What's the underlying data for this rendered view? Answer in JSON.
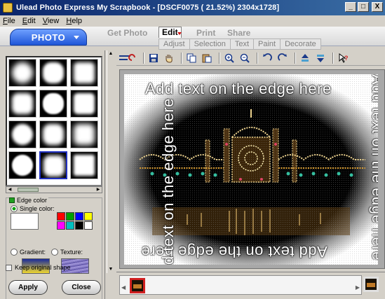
{
  "window": {
    "title": "Ulead Photo Express My Scrapbook - [DSCF0075 ( 21.52%) 2304x1728]",
    "minimize": "_",
    "maximize": "□",
    "close": "X"
  },
  "menu": [
    "File",
    "Edit",
    "View",
    "Help"
  ],
  "modes": {
    "photo": "PHOTO",
    "tabs": [
      "Get Photo",
      "Edit",
      "Print",
      "Share"
    ],
    "active_tab": "Edit"
  },
  "subtabs": [
    "Adjust",
    "Selection",
    "Text",
    "Paint",
    "Decorate"
  ],
  "edge_panel": {
    "edge_color_label": "Edge color",
    "single_color_label": "Single color:",
    "gradient_label": "Gradient:",
    "texture_label": "Texture:",
    "keep_shape_label": "Keep original shape",
    "selected_color": "#ffffff",
    "palette": [
      "#ff0000",
      "#00a000",
      "#0000ff",
      "#ffff00",
      "#ff00ff",
      "#00c0c0",
      "#000000",
      "#ffffff"
    ],
    "gradient_colors": [
      "#1a2a9a",
      "#f0d830"
    ],
    "selected_preset": 10
  },
  "buttons": {
    "apply": "Apply",
    "close": "Close"
  },
  "canvas": {
    "edge_text": "Add text on the edge here"
  },
  "toolbar_icons": [
    "undo-icon",
    "save-icon",
    "hand-icon",
    "copy-icon",
    "paste-icon",
    "zoom-in-icon",
    "zoom-out-icon",
    "rotate-left-icon",
    "rotate-right-icon",
    "flip-up-icon",
    "flip-down-icon",
    "help-icon"
  ]
}
